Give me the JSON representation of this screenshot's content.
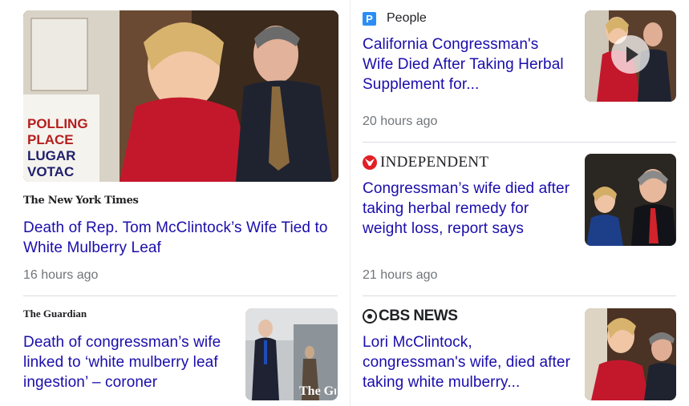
{
  "left": {
    "feature": {
      "publisher": "The New York Times",
      "headline": "Death of Rep. Tom McClintock’s Wife Tied to White Mulberry Leaf",
      "time": "16 hours ago",
      "image_alt": "Polling place photo",
      "sign_text": "POLLING PLACE",
      "sign_text2": "LUGAR\nVOTAC"
    },
    "guardian": {
      "publisher": "The Guardian",
      "headline": "Death of congressman’s wife linked to ‘white mulberry leaf ingestion’ – coroner",
      "watermark": "The Guardi"
    }
  },
  "right": {
    "people": {
      "publisher": "People",
      "logo_letter": "P",
      "headline": "California Congressman's Wife Died After Taking Herbal Supplement for...",
      "time": "20 hours ago"
    },
    "independent": {
      "publisher": "INDEPENDENT",
      "headline": "Congressman’s wife died after taking herbal remedy for weight loss, report says",
      "time": "21 hours ago"
    },
    "cbs": {
      "publisher": "CBS NEWS",
      "headline": "Lori McClintock, congressman's wife, died after taking white mulberry..."
    }
  },
  "colors": {
    "link": "#1a0dab",
    "meta": "#70757a",
    "divider": "#dadce0",
    "people_badge": "#2a8ef4",
    "independent_red": "#e21f26"
  }
}
